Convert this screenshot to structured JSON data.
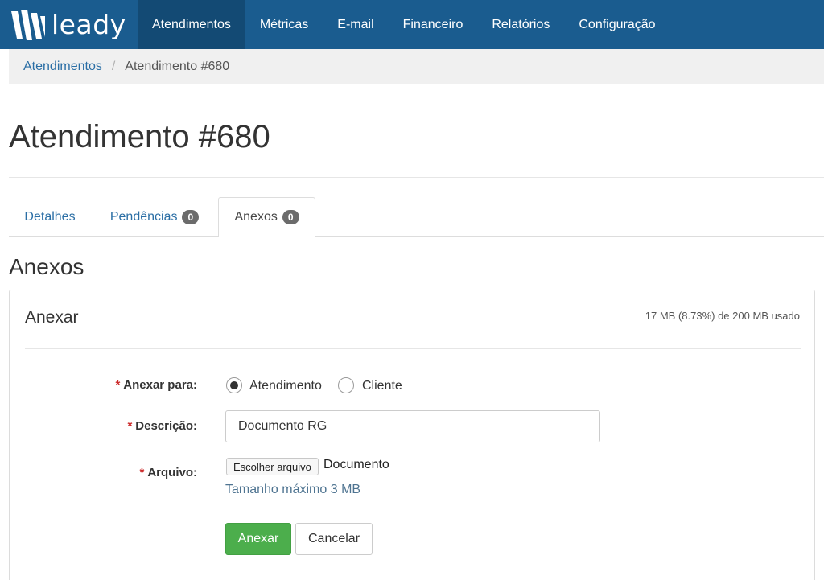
{
  "brand": {
    "name": "leady",
    "logo_icon": "leady-logo-icon"
  },
  "nav": {
    "items": [
      {
        "label": "Atendimentos",
        "active": true
      },
      {
        "label": "Métricas",
        "active": false
      },
      {
        "label": "E-mail",
        "active": false
      },
      {
        "label": "Financeiro",
        "active": false
      },
      {
        "label": "Relatórios",
        "active": false
      },
      {
        "label": "Configuração",
        "active": false
      }
    ]
  },
  "breadcrumb": {
    "parent": "Atendimentos",
    "separator": "/",
    "current": "Atendimento #680"
  },
  "page": {
    "title": "Atendimento #680"
  },
  "tabs": [
    {
      "label": "Detalhes",
      "active": false
    },
    {
      "label": "Pendências",
      "badge": "0",
      "active": false
    },
    {
      "label": "Anexos",
      "badge": "0",
      "active": true
    }
  ],
  "section": {
    "title": "Anexos"
  },
  "panel": {
    "title": "Anexar",
    "usage": "17 MB (8.73%) de 200 MB usado",
    "form": {
      "required_mark": "*",
      "attach_to": {
        "label": "Anexar para:",
        "options": [
          {
            "label": "Atendimento",
            "checked": true
          },
          {
            "label": "Cliente",
            "checked": false
          }
        ]
      },
      "description": {
        "label": "Descrição:",
        "value": "Documento RG"
      },
      "file": {
        "label": "Arquivo:",
        "button_label": "Escolher arquivo",
        "file_name": "Documento",
        "help": "Tamanho máximo 3 MB"
      },
      "submit_label": "Anexar",
      "cancel_label": "Cancelar"
    }
  },
  "colors": {
    "navbar": "#1a5c8f",
    "navbar_active": "#134a74",
    "link": "#2a6ea5",
    "primary_button": "#4cae4c",
    "required": "#cc2a2a"
  }
}
